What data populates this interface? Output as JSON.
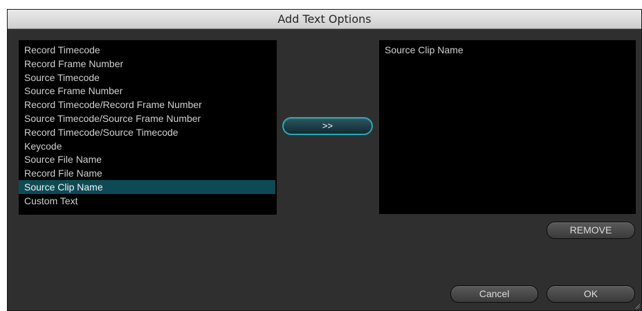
{
  "window": {
    "title": "Add Text Options"
  },
  "available_list": {
    "items": [
      "Record Timecode",
      "Record Frame Number",
      "Source Timecode",
      "Source Frame Number",
      "Record Timecode/Record Frame Number",
      "Source Timecode/Source Frame Number",
      "Record Timecode/Source Timecode",
      "Keycode",
      "Source File Name",
      "Record File Name",
      "Source Clip Name",
      "Custom Text"
    ],
    "selected": "Source Clip Name"
  },
  "selected_list": {
    "items": [
      "Source Clip Name"
    ]
  },
  "buttons": {
    "add_label": ">>",
    "remove_label": "REMOVE",
    "cancel_label": "Cancel",
    "ok_label": "OK"
  },
  "colors": {
    "panel_bg": "#2f2f2f",
    "list_bg": "#000000",
    "selection_bg": "#0e4a55",
    "accent": "#2aa6b8"
  }
}
